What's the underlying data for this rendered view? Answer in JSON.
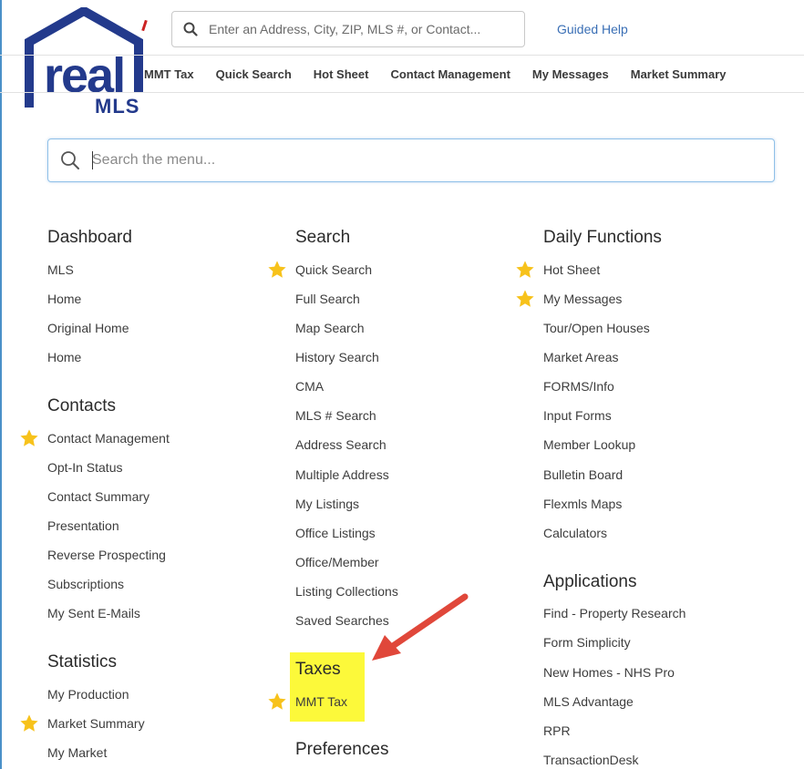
{
  "logo": {
    "word": "real",
    "sub": "MLS"
  },
  "top_search": {
    "placeholder": "Enter an Address, City, ZIP, MLS #, or Contact..."
  },
  "guided_help": "Guided Help",
  "nav": [
    "MMT Tax",
    "Quick Search",
    "Hot Sheet",
    "Contact Management",
    "My Messages",
    "Market Summary"
  ],
  "menu_search": {
    "placeholder": "Search the menu..."
  },
  "colors": {
    "brand": "#233a8c",
    "link": "#3a6fb5",
    "star": "#f7c21b",
    "highlight": "#fcf93a",
    "arrow": "#e0473a"
  },
  "columns": {
    "dashboard": {
      "title": "Dashboard",
      "items": [
        "MLS",
        "Home",
        "Original Home",
        "Home"
      ]
    },
    "contacts": {
      "title": "Contacts",
      "items": [
        "Contact Management",
        "Opt-In Status",
        "Contact Summary",
        "Presentation",
        "Reverse Prospecting",
        "Subscriptions",
        "My Sent E-Mails"
      ]
    },
    "statistics": {
      "title": "Statistics",
      "items": [
        "My Production",
        "Market Summary",
        "My Market"
      ]
    },
    "search": {
      "title": "Search",
      "items": [
        "Quick Search",
        "Full Search",
        "Map Search",
        "History Search",
        "CMA",
        "MLS # Search",
        "Address Search",
        "Multiple Address",
        "My Listings",
        "Office Listings",
        "Office/Member",
        "Listing Collections",
        "Saved Searches"
      ]
    },
    "taxes": {
      "title": "Taxes",
      "items": [
        "MMT Tax"
      ]
    },
    "preferences": {
      "title": "Preferences"
    },
    "daily": {
      "title": "Daily Functions",
      "items": [
        "Hot Sheet",
        "My Messages",
        "Tour/Open Houses",
        "Market Areas",
        "FORMS/Info",
        "Input Forms",
        "Member Lookup",
        "Bulletin Board",
        "Flexmls Maps",
        "Calculators"
      ]
    },
    "applications": {
      "title": "Applications",
      "items": [
        "Find - Property Research",
        "Form Simplicity",
        "New Homes - NHS Pro",
        "MLS Advantage",
        "RPR",
        "TransactionDesk"
      ]
    }
  }
}
